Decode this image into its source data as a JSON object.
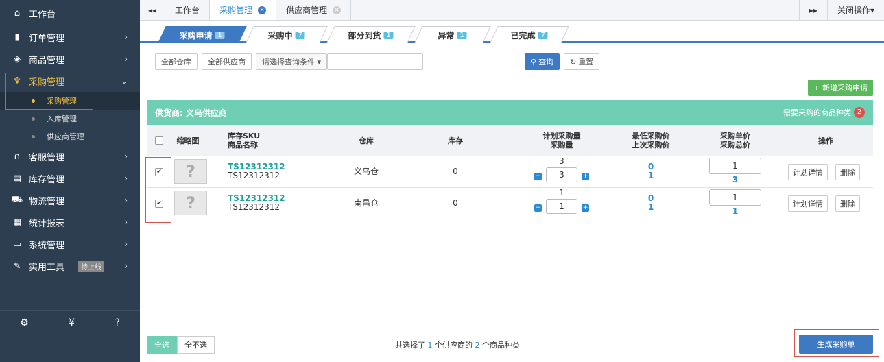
{
  "sidebar": {
    "items": [
      {
        "icon": "home-icon",
        "glyph": "⌂",
        "label": "工作台"
      },
      {
        "icon": "clipboard-icon",
        "glyph": "▮",
        "label": "订单管理"
      },
      {
        "icon": "box-icon",
        "glyph": "◈",
        "label": "商品管理"
      },
      {
        "icon": "cart-icon",
        "glyph": "♆",
        "label": "采购管理"
      },
      {
        "icon": "headset-icon",
        "glyph": "∩",
        "label": "客服管理"
      },
      {
        "icon": "storage-icon",
        "glyph": "▤",
        "label": "库存管理"
      },
      {
        "icon": "truck-icon",
        "glyph": "⛟",
        "label": "物流管理"
      },
      {
        "icon": "report-icon",
        "glyph": "▦",
        "label": "统计报表"
      },
      {
        "icon": "monitor-icon",
        "glyph": "▭",
        "label": "系统管理"
      },
      {
        "icon": "wrench-icon",
        "glyph": "✎",
        "label": "实用工具",
        "badge": "待上线"
      }
    ],
    "subitems": [
      "采购管理",
      "入库管理",
      "供应商管理"
    ],
    "bottom_icons": [
      "settings-icon",
      "yen-icon",
      "help-icon"
    ]
  },
  "topbar": {
    "collapse": "◂◂",
    "tabs": [
      "工作台",
      "采购管理",
      "供应商管理"
    ],
    "forward": "▸▸",
    "close_ops": "关闭操作▾"
  },
  "status_tabs": [
    {
      "label": "采购申请",
      "count": "1"
    },
    {
      "label": "采购中",
      "count": "7"
    },
    {
      "label": "部分到货",
      "count": "1"
    },
    {
      "label": "异常",
      "count": "1"
    },
    {
      "label": "已完成",
      "count": "7"
    }
  ],
  "filters": {
    "warehouse": "全部仓库",
    "supplier": "全部供应商",
    "condition": "请选择查询条件 ▾",
    "search_value": "",
    "query": "查询",
    "reset": "重置"
  },
  "add_button": "+ 新增采购申请",
  "panel": {
    "supplier": "供货商: 义乌供应商",
    "need_label": "需要采购的商品种类",
    "need_count": "2"
  },
  "headers": {
    "thumb": "缩略图",
    "sku": "库存SKU",
    "name": "商品名称",
    "warehouse": "仓库",
    "stock": "库存",
    "plan_qty": "计划采购量",
    "qty": "采购量",
    "min_price": "最低采购价",
    "last_price": "上次采购价",
    "unit_price": "采购单价",
    "total": "采购总价",
    "ops": "操作"
  },
  "rows": [
    {
      "sku": "TS12312312",
      "name": "TS12312312",
      "warehouse": "义乌仓",
      "stock": "0",
      "plan": "3",
      "qty": "3",
      "min": "0",
      "last": "1",
      "unit": "1",
      "total": "3"
    },
    {
      "sku": "TS12312312",
      "name": "TS12312312",
      "warehouse": "南昌仓",
      "stock": "0",
      "plan": "1",
      "qty": "1",
      "min": "0",
      "last": "1",
      "unit": "1",
      "total": "1"
    }
  ],
  "row_actions": {
    "detail": "计划详情",
    "delete": "删除"
  },
  "footer": {
    "select_all": "全选",
    "select_none": "全不选",
    "summary_a": "共选择了",
    "supplier_count": "1",
    "summary_b": "个供应商的",
    "kind_count": "2",
    "summary_c": "个商品种类",
    "generate": "生成采购单"
  },
  "colors": {
    "accent": "#3d7ac3",
    "panel": "#6fcfb4",
    "sidebar": "#2c3e50",
    "active": "#f0c040"
  }
}
